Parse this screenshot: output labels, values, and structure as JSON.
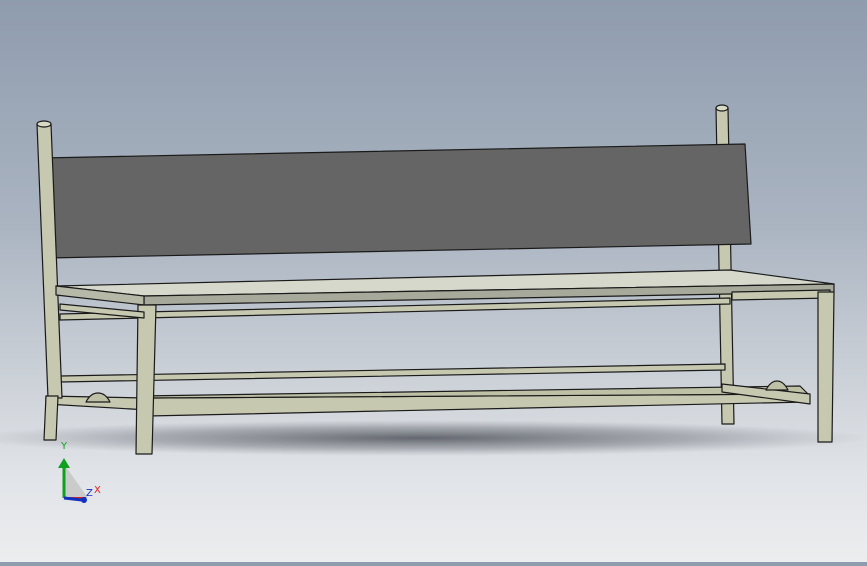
{
  "triad": {
    "x_label": "X",
    "y_label": "Y",
    "z_label": "Z",
    "x_color": "#e02020",
    "y_color": "#10a020",
    "z_color": "#1030c0"
  },
  "model": {
    "frame_color": "#c6c8b0",
    "backrest_color": "#656565",
    "seat_color": "#d6d8cc",
    "edge_color": "#1a1a1a"
  }
}
